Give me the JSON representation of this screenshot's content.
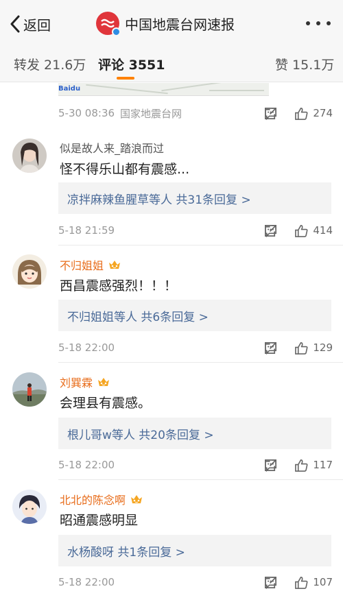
{
  "nav": {
    "back_label": "返回",
    "title": "中国地震台网速报"
  },
  "tabs": {
    "repost": "转发 21.6万",
    "comment": "评论 3551",
    "like": "赞 15.1万"
  },
  "post": {
    "time": "5-30 08:36",
    "source": "国家地震台网",
    "likes": "274"
  },
  "comments": [
    {
      "name": "似是故人来_踏浪而过",
      "vip": false,
      "text": "怪不得乐山都有震感...",
      "replies": "凉拌麻辣鱼腥草等人 共31条回复 >",
      "time": "5-18 21:59",
      "likes": "414"
    },
    {
      "name": "不归姐姐",
      "vip": true,
      "text": "西昌震感强烈！！！",
      "replies": "不归姐姐等人 共6条回复 >",
      "time": "5-18 22:00",
      "likes": "129"
    },
    {
      "name": "刘巽霖",
      "vip": true,
      "text": "会理县有震感。",
      "replies": "根儿哥w等人 共20条回复 >",
      "time": "5-18 22:00",
      "likes": "117"
    },
    {
      "name": "北北的陈念啊",
      "vip": true,
      "text": "昭通震感明显",
      "replies": "水杨酸呀 共1条回复 >",
      "time": "5-18 22:00",
      "likes": "107"
    }
  ],
  "icons": {
    "back": "chevron-left-icon",
    "more": "more-dots-icon",
    "forward": "share-icon",
    "comment": "comment-icon",
    "like": "thumb-up-icon",
    "vip": "crown-icon"
  },
  "colors": {
    "accent": "#ff8200",
    "brand_red": "#e0353b",
    "vip_name": "#e86c1a",
    "reply_link": "#4a6a98"
  }
}
